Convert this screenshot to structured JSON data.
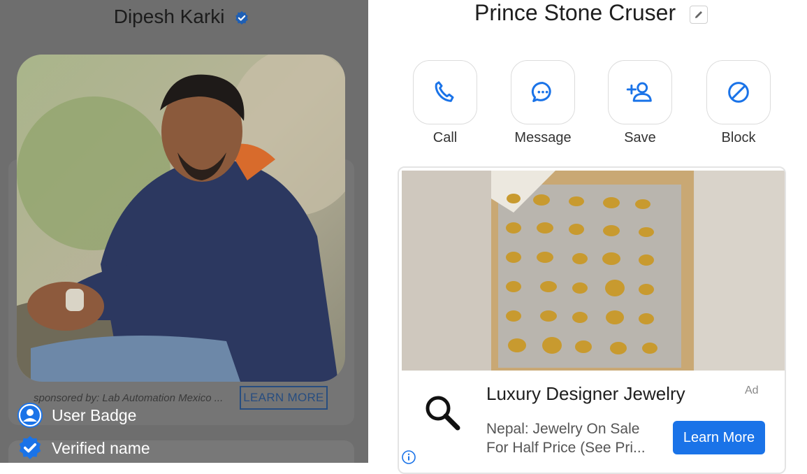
{
  "left": {
    "profile_name": "Dipesh Karki",
    "sponsor_text": "sponsored by: Lab Automation Mexico ...",
    "learn_more_label": "LEARN MORE",
    "badges": [
      {
        "label": "User Badge",
        "icon": "user-circle-icon"
      },
      {
        "label": "Verified name",
        "icon": "verified-check-icon"
      }
    ]
  },
  "right": {
    "contact_name": "Prince Stone Cruser",
    "actions": [
      {
        "label": "Call",
        "icon": "phone-icon"
      },
      {
        "label": "Message",
        "icon": "chat-bubble-icon"
      },
      {
        "label": "Save",
        "icon": "add-contact-icon"
      },
      {
        "label": "Block",
        "icon": "block-icon"
      }
    ],
    "ad": {
      "title": "Luxury Designer Jewelry",
      "tag": "Ad",
      "description_line1": "Nepal: Jewelry On Sale",
      "description_line2": "For Half Price (See Pri...",
      "cta": "Learn More"
    }
  },
  "colors": {
    "accent": "#1a73e8",
    "verified": "#1e5fb4",
    "overlay": "#6e6e6e"
  }
}
